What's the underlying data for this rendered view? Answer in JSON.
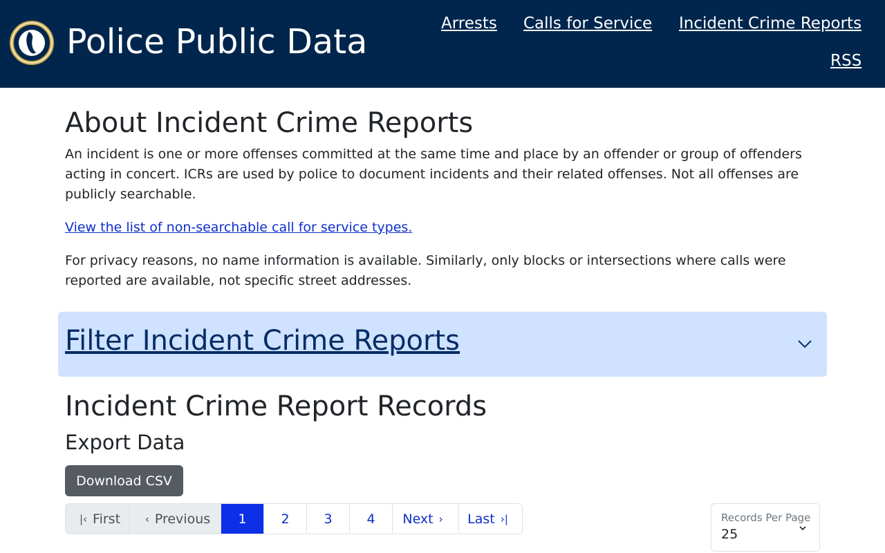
{
  "header": {
    "site_title": "Police Public Data",
    "nav": {
      "arrests": "Arrests",
      "calls_for_service": "Calls for Service",
      "incident_crime_reports": "Incident Crime Reports",
      "rss": "RSS"
    }
  },
  "about": {
    "title": "About Incident Crime Reports",
    "paragraph1": "An incident is one or more offenses committed at the same time and place by an offender or group of offenders acting in concert. ICRs are used by police to document incidents and their related offenses. Not all offenses are publicly searchable.",
    "nonsearchable_link": "View the list of non-searchable call for service types.",
    "paragraph2": "For privacy reasons, no name information is available. Similarly, only blocks or intersections where calls were reported are available, not specific street addresses."
  },
  "filter": {
    "title": "Filter Incident Crime Reports",
    "expand_icon": "chevron-down-icon"
  },
  "records": {
    "title": "Incident Crime Report Records",
    "export_title": "Export Data",
    "download_label": "Download CSV"
  },
  "pagination": {
    "first": "First",
    "previous": "Previous",
    "pages": [
      "1",
      "2",
      "3",
      "4"
    ],
    "current_page": "1",
    "next": "Next",
    "last": "Last"
  },
  "records_per_page": {
    "label": "Records Per Page",
    "value": "25"
  },
  "colors": {
    "header_bg": "#00264d",
    "accent": "#0d2fe6",
    "filter_bg": "#cfe2ff",
    "button_bg": "#555b61"
  }
}
